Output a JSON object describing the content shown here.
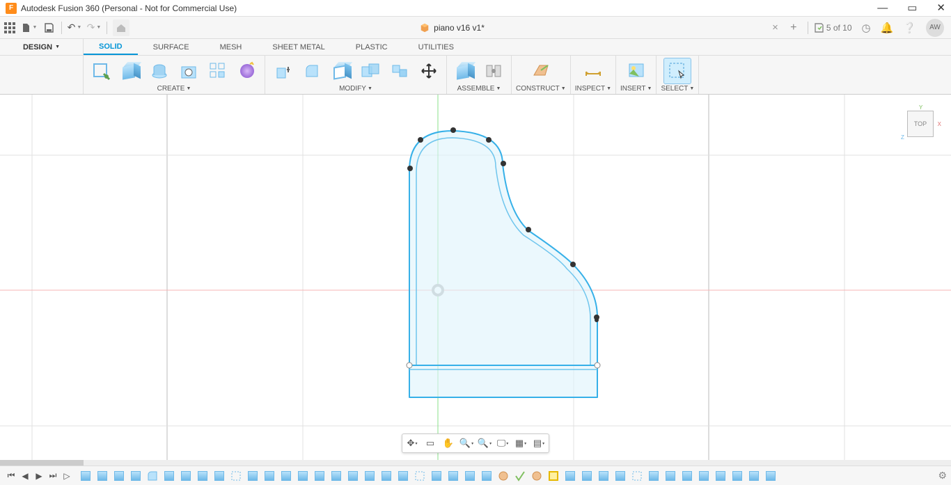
{
  "app": {
    "title": "Autodesk Fusion 360 (Personal - Not for Commercial Use)"
  },
  "tab": {
    "name": "piano v16 v1*"
  },
  "saveStatus": {
    "count": "5 of 10"
  },
  "avatar": {
    "initials": "AW"
  },
  "workspace": {
    "label": "DESIGN"
  },
  "ribbonTabs": [
    "SOLID",
    "SURFACE",
    "MESH",
    "SHEET METAL",
    "PLASTIC",
    "UTILITIES"
  ],
  "groups": {
    "create": "CREATE",
    "modify": "MODIFY",
    "assemble": "ASSEMBLE",
    "construct": "CONSTRUCT",
    "inspect": "INSPECT",
    "insert": "INSERT",
    "select": "SELECT"
  },
  "viewcube": {
    "face": "TOP",
    "y": "Y",
    "x": "X",
    "z": "Z"
  }
}
